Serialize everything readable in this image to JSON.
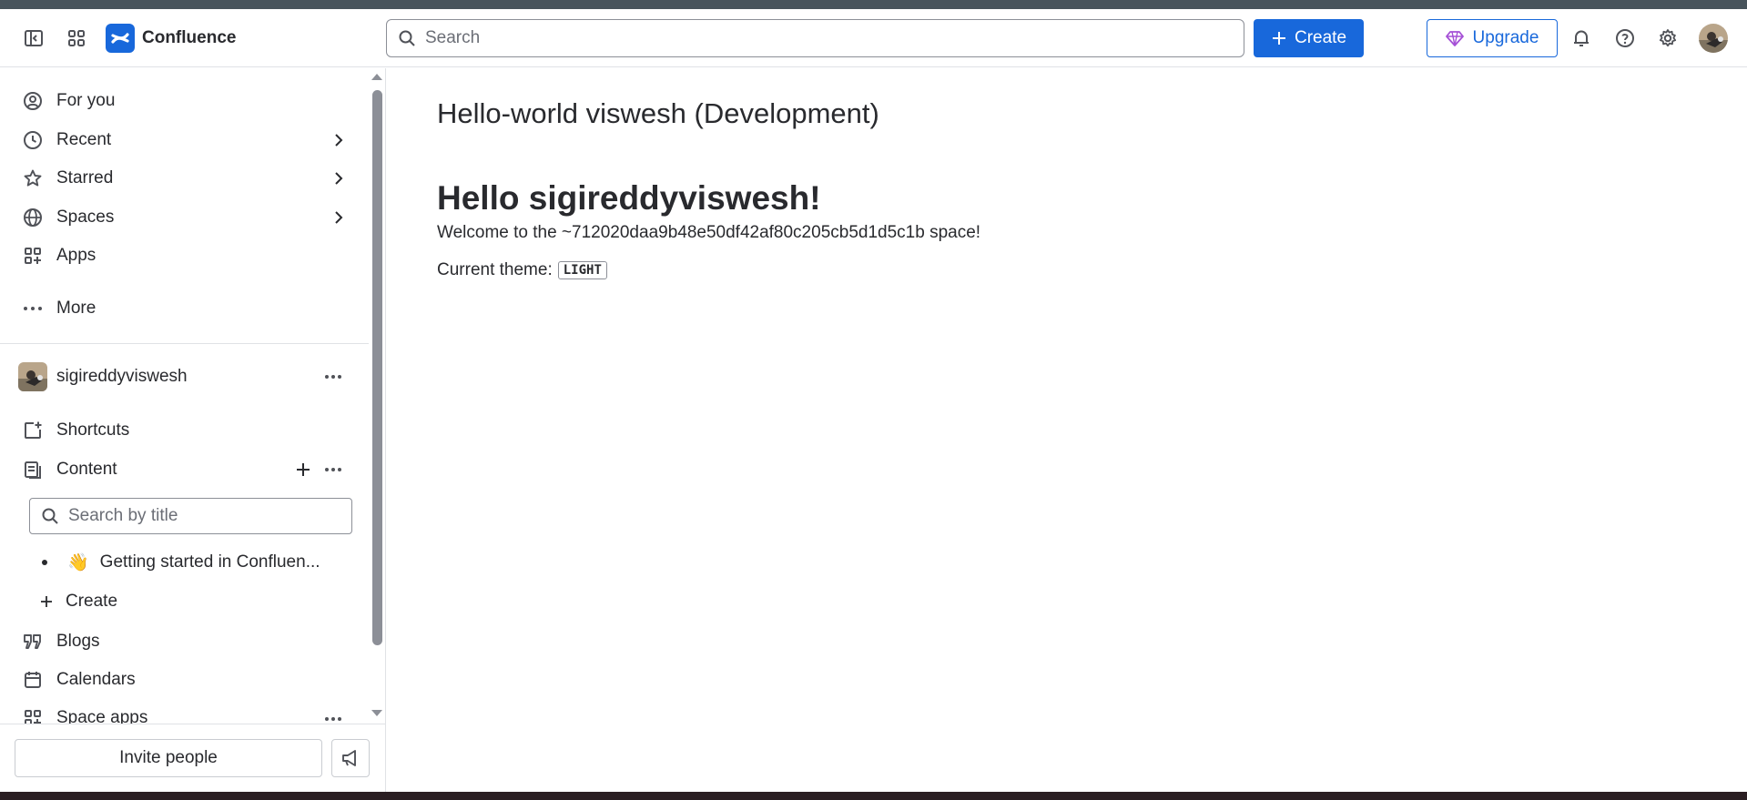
{
  "colors": {
    "accent": "#1868db",
    "text": "#292a2e",
    "subtle": "#6b6e76",
    "upgrade_gem": "#a550d6"
  },
  "header": {
    "app_name": "Confluence",
    "search_placeholder": "Search",
    "create_label": "Create",
    "upgrade_label": "Upgrade",
    "icons": [
      "sidebar-toggle-icon",
      "app-switcher-icon",
      "bell-icon",
      "help-icon",
      "gear-icon"
    ]
  },
  "sidebar": {
    "nav": [
      {
        "label": "For you",
        "icon": "person-circle-icon"
      },
      {
        "label": "Recent",
        "icon": "clock-icon"
      },
      {
        "label": "Starred",
        "icon": "star-icon"
      },
      {
        "label": "Spaces",
        "icon": "globe-icon"
      },
      {
        "label": "Apps",
        "icon": "apps-icon"
      },
      {
        "label": "More",
        "icon": "more-icon"
      }
    ],
    "space_owner": "sigireddyviswesh",
    "space_items": [
      {
        "label": "Shortcuts",
        "icon": "shortcut-icon"
      },
      {
        "label": "Content",
        "icon": "content-icon"
      }
    ],
    "title_search_placeholder": "Search by title",
    "tree": [
      {
        "emoji": "👋",
        "label": "Getting started in Confluen..."
      }
    ],
    "tree_create_label": "Create",
    "bottom_items": [
      {
        "label": "Blogs",
        "icon": "quote-icon"
      },
      {
        "label": "Calendars",
        "icon": "calendar-icon"
      },
      {
        "label": "Space apps",
        "icon": "apps-icon"
      }
    ],
    "invite_label": "Invite people"
  },
  "main": {
    "page_title": "Hello-world viswesh (Development)",
    "heading": "Hello sigireddyviswesh!",
    "welcome": "Welcome to the ~712020daa9b48e50df42af80c205cb5d1d5c1b space!",
    "theme_label": "Current theme:",
    "theme_value": "LIGHT"
  }
}
